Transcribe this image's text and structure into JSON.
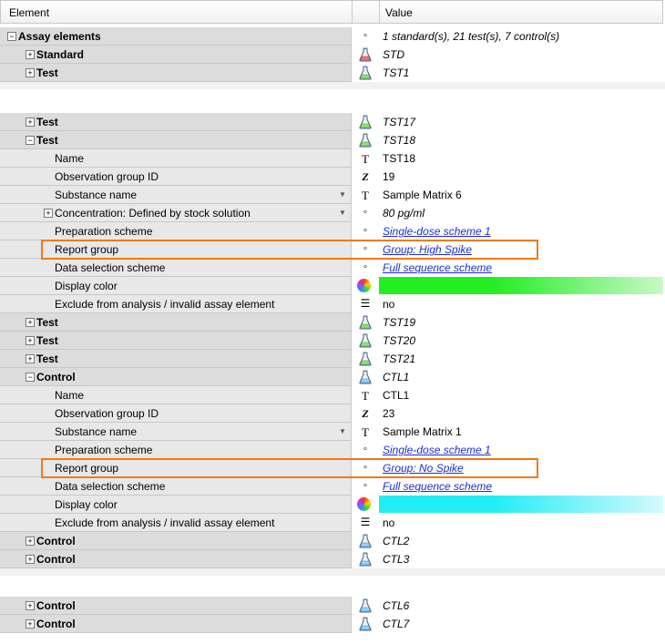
{
  "header": {
    "element_label": "Element",
    "value_label": "Value"
  },
  "rows_top": [
    {
      "label": "Assay elements",
      "expander": "−",
      "level": 0,
      "icon": "dot-icon",
      "value": "1 standard(s), 21 test(s), 7 control(s)",
      "style": "it"
    },
    {
      "label": "Standard",
      "expander": "+",
      "level": 1,
      "icon": "flask-red-icon",
      "value": "STD",
      "style": "it"
    },
    {
      "label": "Test",
      "expander": "+",
      "level": 1,
      "icon": "flask-green-icon",
      "value": "TST1",
      "style": "it"
    }
  ],
  "rows_mid": [
    {
      "label": "Test",
      "expander": "+",
      "level": 1,
      "icon": "flask-green-icon",
      "value": "TST17",
      "style": "it"
    },
    {
      "label": "Test",
      "expander": "−",
      "level": 1,
      "icon": "flask-green-icon",
      "value": "TST18",
      "style": "it"
    },
    {
      "label": "Name",
      "level": 2,
      "icon": "text-icon",
      "value": "TST18"
    },
    {
      "label": "Observation group ID",
      "level": 2,
      "icon": "integer-icon",
      "value": "19"
    },
    {
      "label": "Substance name",
      "level": 2,
      "icon": "text-icon",
      "value": "Sample Matrix 6",
      "dropdown": true
    },
    {
      "label": "Concentration: Defined by stock solution",
      "expander": "+",
      "level": 2,
      "icon": "dot-icon",
      "value": "80 pg/ml",
      "style": "it",
      "dropdown": true
    },
    {
      "label": "Preparation scheme",
      "level": 2,
      "icon": "dot-icon",
      "value": "Single-dose scheme 1",
      "style": "link"
    },
    {
      "label": "Report group",
      "level": 2,
      "icon": "dot-icon",
      "value": "Group: High Spike",
      "style": "link"
    },
    {
      "label": "Data selection scheme",
      "level": 2,
      "icon": "dot-icon",
      "value": "Full sequence scheme",
      "style": "link"
    },
    {
      "label": "Display color",
      "level": 2,
      "icon": "color-wheel-icon",
      "value": "",
      "swatch": "green"
    },
    {
      "label": "Exclude from analysis / invalid assay element",
      "level": 2,
      "icon": "list-icon",
      "value": "no"
    },
    {
      "label": "Test",
      "expander": "+",
      "level": 1,
      "icon": "flask-green-icon",
      "value": "TST19",
      "style": "it"
    },
    {
      "label": "Test",
      "expander": "+",
      "level": 1,
      "icon": "flask-green-icon",
      "value": "TST20",
      "style": "it"
    },
    {
      "label": "Test",
      "expander": "+",
      "level": 1,
      "icon": "flask-green-icon",
      "value": "TST21",
      "style": "it"
    },
    {
      "label": "Control",
      "expander": "−",
      "level": 1,
      "icon": "flask-blue-icon",
      "value": "CTL1",
      "style": "it"
    },
    {
      "label": "Name",
      "level": 2,
      "icon": "text-icon",
      "value": "CTL1"
    },
    {
      "label": "Observation group ID",
      "level": 2,
      "icon": "integer-icon",
      "value": "23"
    },
    {
      "label": "Substance name",
      "level": 2,
      "icon": "text-icon",
      "value": "Sample Matrix 1",
      "dropdown": true
    },
    {
      "label": "Preparation scheme",
      "level": 2,
      "icon": "dot-icon",
      "value": "Single-dose scheme 1",
      "style": "link"
    },
    {
      "label": "Report group",
      "level": 2,
      "icon": "dot-icon",
      "value": "Group: No Spike",
      "style": "link"
    },
    {
      "label": "Data selection scheme",
      "level": 2,
      "icon": "dot-icon",
      "value": "Full sequence scheme",
      "style": "link"
    },
    {
      "label": "Display color",
      "level": 2,
      "icon": "color-wheel-icon",
      "value": "",
      "swatch": "cyan"
    },
    {
      "label": "Exclude from analysis / invalid assay element",
      "level": 2,
      "icon": "list-icon",
      "value": "no"
    },
    {
      "label": "Control",
      "expander": "+",
      "level": 1,
      "icon": "flask-blue-icon",
      "value": "CTL2",
      "style": "it"
    },
    {
      "label": "Control",
      "expander": "+",
      "level": 1,
      "icon": "flask-blue-icon",
      "value": "CTL3",
      "style": "it"
    }
  ],
  "rows_bottom": [
    {
      "label": "Control",
      "expander": "+",
      "level": 1,
      "icon": "flask-blue-icon",
      "value": "CTL6",
      "style": "it"
    },
    {
      "label": "Control",
      "expander": "+",
      "level": 1,
      "icon": "flask-blue-icon",
      "value": "CTL7",
      "style": "it"
    }
  ],
  "colors": {
    "highlight": "#f07a12",
    "link": "#1a2fd6",
    "swatch_green": [
      "#22ee22",
      "#c8f8c8"
    ],
    "swatch_cyan": [
      "#22ecf6",
      "#d4fafd"
    ]
  }
}
